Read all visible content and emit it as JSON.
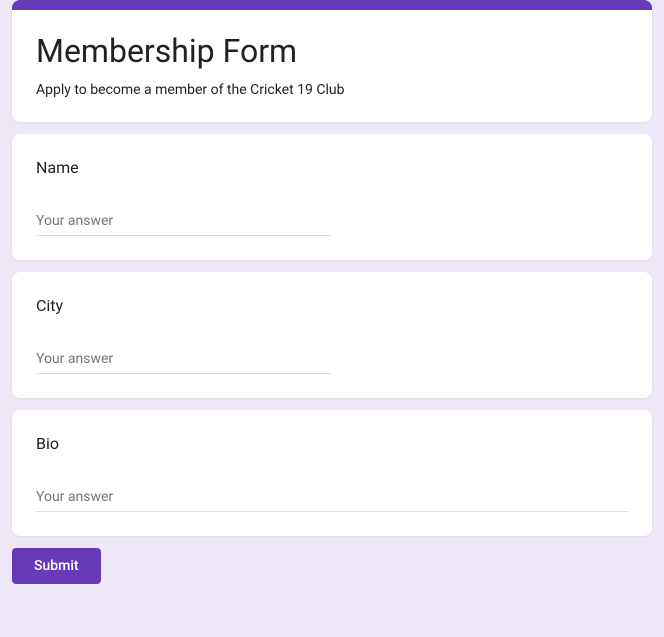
{
  "header": {
    "title": "Membership Form",
    "description": "Apply to become a member of the Cricket 19 Club"
  },
  "questions": [
    {
      "label": "Name",
      "placeholder": "Your answer",
      "value": "",
      "full_width": false
    },
    {
      "label": "City",
      "placeholder": "Your answer",
      "value": "",
      "full_width": false
    },
    {
      "label": "Bio",
      "placeholder": "Your answer",
      "value": "",
      "full_width": true
    }
  ],
  "submit_label": "Submit"
}
